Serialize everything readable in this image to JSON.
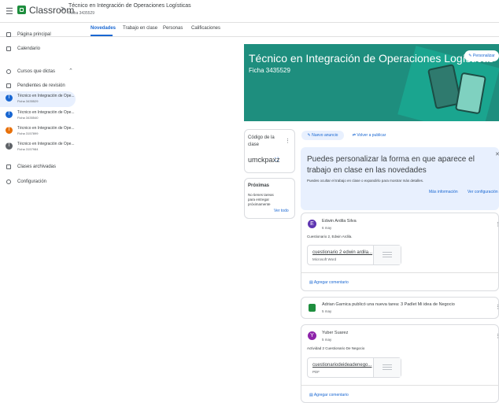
{
  "header": {
    "menu_icon": "hamburger-menu-icon",
    "app_name": "Classroom",
    "separator": ">",
    "course_title": "Técnico en Integración de Operaciones Logísticas",
    "course_ficha": "Ficha 3435529"
  },
  "tabs": [
    {
      "label": "Novedades"
    },
    {
      "label": "Trabajo en clase"
    },
    {
      "label": "Personas"
    },
    {
      "label": "Calificaciones"
    }
  ],
  "sidebar": {
    "home": "Página principal",
    "calendar": "Calendario",
    "teaching_section": "Cursos que dictas",
    "pending": "Pendientes de revisión",
    "courses": [
      {
        "initial": "T",
        "name": "Técnico en Integración de Ope...",
        "ficha": "Ficha 3435529",
        "color": "#1967d2"
      },
      {
        "initial": "T",
        "name": "Técnico en Integración de Ope...",
        "ficha": "Ficha 3435540",
        "color": "#1967d2"
      },
      {
        "initial": "T",
        "name": "Técnico en Integración de Ope...",
        "ficha": "Ficha 3157899",
        "color": "#e8710a"
      },
      {
        "initial": "T",
        "name": "Técnico en Integración de Ope...",
        "ficha": "Ficha 3157984",
        "color": "#5f6368"
      }
    ],
    "archived": "Clases archivadas",
    "settings": "Configuración"
  },
  "banner": {
    "title": "Técnico en Integración de Operaciones Logísticas",
    "subtitle": "Ficha 3435529",
    "customize_label": "Personalizar",
    "color": "#1e8e7e"
  },
  "code_card": {
    "label": "Código de la clase",
    "code": "umckpaxz"
  },
  "upcoming": {
    "title": "Próximas",
    "text": "No tienes tareas para entregar próximamente",
    "view_all": "Ver todo"
  },
  "actions": {
    "new_announcement": "Nuevo anuncio",
    "repost": "Volver a publicar"
  },
  "info_card": {
    "title": "Puedes personalizar la forma en que aparece el trabajo en clase en las novedades",
    "text": "Puedes ocultar el trabajo en clase o expandirlo para mostrar más detalles.",
    "more_info": "Más información",
    "settings_link": "Ver configuración"
  },
  "posts": [
    {
      "initial": "E",
      "color": "#5e35b1",
      "author": "Edwin Ardila Silva",
      "date": "6 may",
      "body": "Cuestionario 2, Edwin Ardila.",
      "attachment": {
        "name": "cuestionario 2 edwin ardila...",
        "type": "Microsoft Word"
      },
      "comment_label": "Agregar comentario"
    },
    {
      "author": "Adrian Garnica publicó una nueva tarea: 3 Padlet Mi idea de Negocio",
      "date": "5 may"
    },
    {
      "initial": "Y",
      "color": "#8e24aa",
      "author": "Yuber Suarez",
      "date": "5 may",
      "body": "Actividad 2 Cuestionario De Negocio",
      "attachment": {
        "name": "cuestionariodeideadenego...",
        "type": "PDF"
      },
      "comment_label": "Agregar comentario"
    }
  ]
}
